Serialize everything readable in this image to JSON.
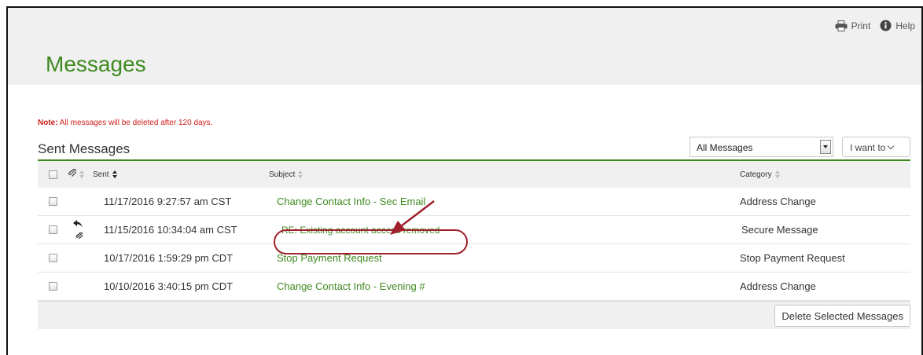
{
  "page": {
    "title": "Messages",
    "utility": {
      "print_label": "Print",
      "help_label": "Help"
    },
    "note_prefix": "Note:",
    "note_text": " All messages will be deleted after 120 days.",
    "section_title": "Sent Messages"
  },
  "filter": {
    "selected": "All Messages",
    "iwant_label": "I want to"
  },
  "table": {
    "columns": {
      "sent": "Sent",
      "subject": "Subject",
      "category": "Category"
    },
    "rows": [
      {
        "sent": "11/17/2016 9:27:57 am CST",
        "subject": "Change Contact Info - Sec Email",
        "category": "Address Change",
        "replied": false,
        "attachment": false
      },
      {
        "sent": "11/15/2016 10:34:04 am CST",
        "subject": "RE: Existing account access removed",
        "category": "Secure Message",
        "replied": true,
        "attachment": true
      },
      {
        "sent": "10/17/2016 1:59:29 pm CDT",
        "subject": "Stop Payment Request",
        "category": "Stop Payment Request",
        "replied": false,
        "attachment": false
      },
      {
        "sent": "10/10/2016 3:40:15 pm CDT",
        "subject": "Change Contact Info - Evening #",
        "category": "Address Change",
        "replied": false,
        "attachment": false
      }
    ]
  },
  "actions": {
    "delete_label": "Delete Selected Messages"
  },
  "colors": {
    "brand_green": "#3f8a1f",
    "note_red": "#d0201c",
    "annotation": "#a0202c"
  }
}
